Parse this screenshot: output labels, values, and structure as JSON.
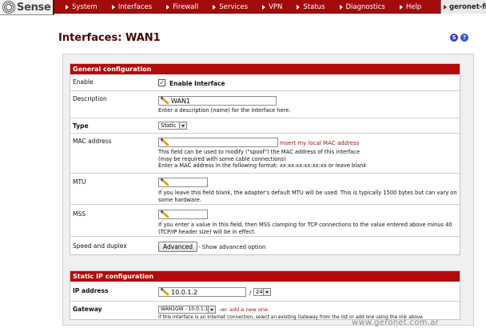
{
  "brand": {
    "logo_text": "Sense",
    "hostname": "geronet-fi"
  },
  "nav": [
    "System",
    "Interfaces",
    "Firewall",
    "Services",
    "VPN",
    "Status",
    "Diagnostics",
    "Help"
  ],
  "page": {
    "title": "Interfaces: WAN1",
    "help_s": "S",
    "help_q": "?"
  },
  "general": {
    "header": "General configuration",
    "enable": {
      "label": "Enable",
      "text": "Enable Interface",
      "checked": true
    },
    "description": {
      "label": "Description",
      "value": "WAN1",
      "hint": "Enter a description (name) for the interface here."
    },
    "type": {
      "label": "Type",
      "value": "Static"
    },
    "mac": {
      "label": "MAC address",
      "value": "",
      "link": "Insert my local MAC address",
      "hint1": "This field can be used to modify (\"spoof\") the MAC address of this interface",
      "hint2": "(may be required with some cable connections)",
      "hint3": "Enter a MAC address in the following format: xx:xx:xx:xx:xx:xx or leave blank"
    },
    "mtu": {
      "label": "MTU",
      "value": "",
      "hint": "If you leave this field blank, the adapter's default MTU will be used. This is typically 1500 bytes but can vary on some hardware."
    },
    "mss": {
      "label": "MSS",
      "value": "",
      "hint": "If you enter a value in this field, then MSS clamping for TCP connections to the value entered above minus 40 (TCP/IP header size) will be in effect."
    },
    "speed": {
      "label": "Speed and duplex",
      "button": "Advanced",
      "text": "- Show advanced option"
    }
  },
  "static": {
    "header": "Static IP configuration",
    "ip": {
      "label": "IP address",
      "value": "10.0.1.2",
      "slash": "/",
      "mask": "24"
    },
    "gateway": {
      "label": "Gateway",
      "value": "WAN1GW - 10.0.1.1",
      "or": "-or-",
      "add": "add a new one.",
      "hint": "If this interface is an Internet connection, select an existing Gateway from the list or add one using the link above"
    }
  },
  "watermark": "www.geronet.com.ar"
}
